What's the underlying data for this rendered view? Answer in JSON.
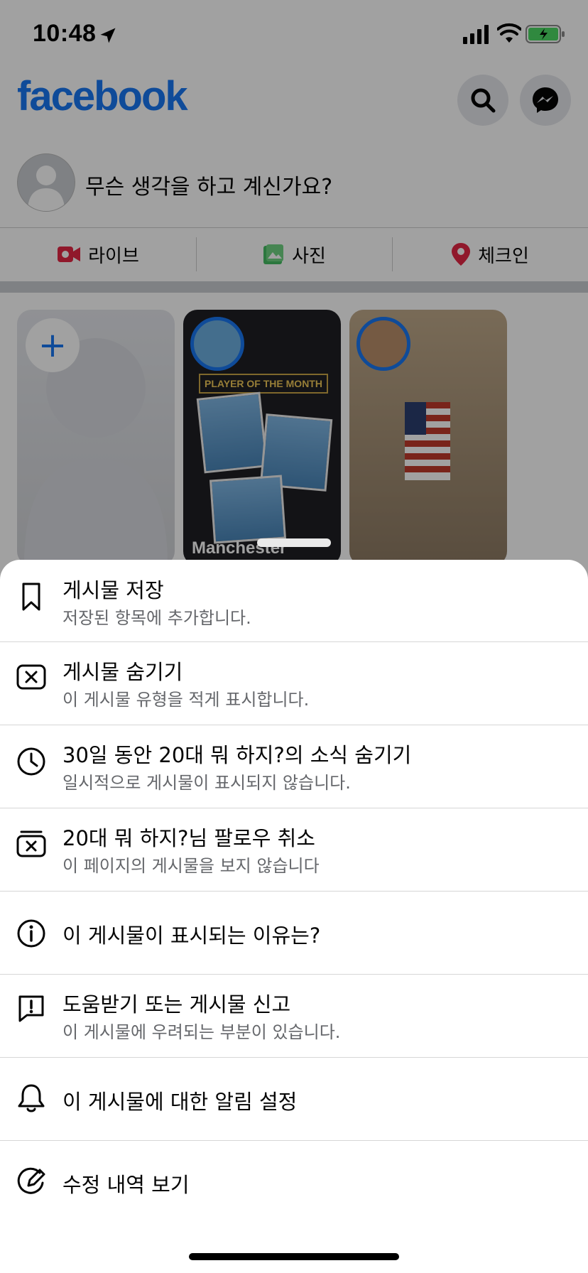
{
  "status": {
    "time": "10:48"
  },
  "header": {
    "logo": "facebook"
  },
  "composer": {
    "placeholder": "무슨 생각을 하고 계신가요?"
  },
  "actions": [
    {
      "label": "라이브",
      "icon": "live-video-icon",
      "color": "#e42645"
    },
    {
      "label": "사진",
      "icon": "photo-icon",
      "color": "#45bd62"
    },
    {
      "label": "체크인",
      "icon": "location-pin-icon",
      "color": "#e42645"
    }
  ],
  "stories": [
    {
      "type": "create"
    },
    {
      "label": "Manchester",
      "banner": "PLAYER OF THE MONTH"
    },
    {
      "label": ""
    }
  ],
  "menu": [
    {
      "title": "게시물 저장",
      "subtitle": "저장된 항목에 추가합니다.",
      "icon": "bookmark-icon"
    },
    {
      "title": "게시물 숨기기",
      "subtitle": "이 게시물 유형을 적게 표시합니다.",
      "icon": "hide-post-icon"
    },
    {
      "title": "30일 동안 20대 뭐 하지?의 소식 숨기기",
      "subtitle": "일시적으로 게시물이 표시되지 않습니다.",
      "icon": "clock-icon"
    },
    {
      "title": "20대 뭐 하지?님 팔로우 취소",
      "subtitle": "이 페이지의 게시물을 보지 않습니다",
      "icon": "unfollow-icon"
    },
    {
      "title": "이 게시물이 표시되는 이유는?",
      "subtitle": "",
      "icon": "info-icon"
    },
    {
      "title": "도움받기 또는 게시물 신고",
      "subtitle": "이 게시물에 우려되는 부분이 있습니다.",
      "icon": "report-icon"
    },
    {
      "title": "이 게시물에 대한 알림 설정",
      "subtitle": "",
      "icon": "bell-icon"
    },
    {
      "title": "수정 내역 보기",
      "subtitle": "",
      "icon": "edit-history-icon"
    }
  ],
  "colors": {
    "brand": "#1877f2",
    "secondary_text": "#65676b"
  }
}
